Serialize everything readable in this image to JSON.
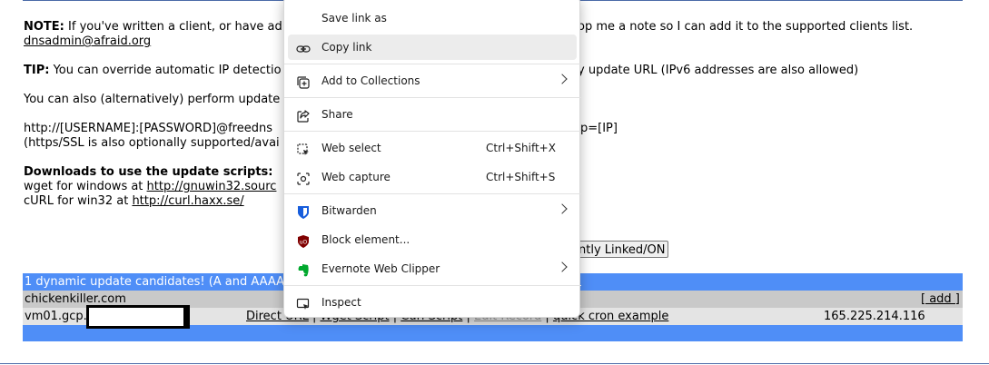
{
  "page": {
    "note_label": "NOTE:",
    "note_text": "If you've written a client, or have ad",
    "note_text_right": "op me a note so I can add it to the supported clients list.",
    "note_email": "dnsadmin@afraid.org",
    "tip_label": "TIP:",
    "tip_text": "You can override automatic IP detectio",
    "tip_text_right": "y update URL (IPv6 addresses are also allowed)",
    "also_text": "You can also (alternatively) perform update",
    "url_text": "http://[USERNAME]:[PASSWORD]@freedns",
    "url_text_right": "p=[IP]",
    "ssl_text": "(https/SSL is also optionally supported/avai",
    "downloads_label": "Downloads to use the update scripts:",
    "wget_prefix": "wget for windows at ",
    "wget_link": "http://gnuwin32.sourc",
    "curl_prefix": "cURL for win32 at ",
    "curl_link": "http://curl.haxx.se/",
    "button_label": "ently Linked/ON"
  },
  "table": {
    "header": "1 dynamic update candidates! (A and AAAA",
    "domain": "chickenkiller.com",
    "add_link": "[ add ]",
    "entry_host": "vm01.gcp.",
    "links": {
      "direct": "Direct URL",
      "wget": "Wget Script",
      "curl": "Curl Script",
      "edit": "Edit Record",
      "cron": "quick cron example",
      "sep": "|"
    },
    "ip": "165.225.214.116"
  },
  "context_menu": {
    "items": [
      {
        "label": "Save link as",
        "icon": "none"
      },
      {
        "label": "Copy link",
        "icon": "link-icon"
      },
      {
        "label": "Add to Collections",
        "icon": "collections-icon"
      },
      {
        "label": "Share",
        "icon": "share-icon"
      },
      {
        "label": "Web select",
        "icon": "web-select-icon",
        "shortcut": "Ctrl+Shift+X"
      },
      {
        "label": "Web capture",
        "icon": "web-capture-icon",
        "shortcut": "Ctrl+Shift+S"
      },
      {
        "label": "Bitwarden",
        "icon": "bitwarden-icon"
      },
      {
        "label": "Block element...",
        "icon": "ublock-icon"
      },
      {
        "label": "Evernote Web Clipper",
        "icon": "evernote-icon"
      },
      {
        "label": "Inspect",
        "icon": "inspect-icon"
      }
    ]
  },
  "colors": {
    "table_header": "#4f8ef7",
    "bitwarden": "#175ddc",
    "ublock": "#800000",
    "evernote": "#00a82d"
  }
}
